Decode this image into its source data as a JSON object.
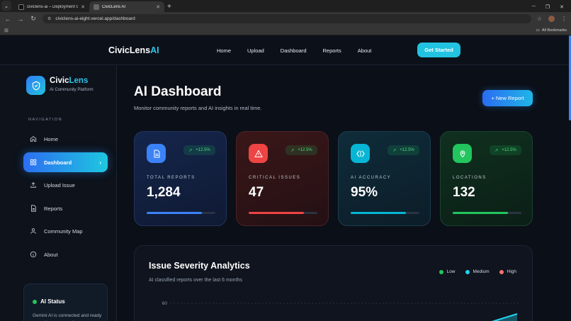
{
  "browser": {
    "tabs": [
      {
        "title": "civiclens-ai – Deployment Ove"
      },
      {
        "title": "CivicLens AI"
      }
    ],
    "url": "civiclens-ai-eight.vercel.app/dashboard",
    "bookmarks_label": "All Bookmarks"
  },
  "header": {
    "logo_main": "CivicLens",
    "logo_accent": "AI",
    "nav": [
      "Home",
      "Upload",
      "Dashboard",
      "Reports",
      "About"
    ],
    "cta_label": "Get Started"
  },
  "sidebar": {
    "brand_main": "Civic",
    "brand_accent": "Lens",
    "brand_subtitle": "AI Community Platform",
    "section_label": "NAVIGATION",
    "items": [
      {
        "label": "Home",
        "icon": "home-icon"
      },
      {
        "label": "Dashboard",
        "icon": "grid-icon"
      },
      {
        "label": "Upload Issue",
        "icon": "upload-icon"
      },
      {
        "label": "Reports",
        "icon": "document-icon"
      },
      {
        "label": "Community Map",
        "icon": "users-icon"
      },
      {
        "label": "About",
        "icon": "info-icon"
      }
    ],
    "status": {
      "title": "AI Status",
      "text": "Gemini AI is connected and ready to analyze community"
    }
  },
  "main": {
    "title": "AI Dashboard",
    "subtitle": "Monitor community reports and AI insights in real time.",
    "new_report_label": "+ New Report",
    "stats": [
      {
        "label": "TOTAL REPORTS",
        "value": "1,284",
        "trend": "+12.5%",
        "progress": 0.8,
        "color": "#3b82f6"
      },
      {
        "label": "CRITICAL ISSUES",
        "value": "47",
        "trend": "+12.5%",
        "progress": 0.8,
        "color": "#ef4444"
      },
      {
        "label": "AI ACCURACY",
        "value": "95%",
        "trend": "+12.5%",
        "progress": 0.8,
        "color": "#06b6d4"
      },
      {
        "label": "LOCATIONS",
        "value": "132",
        "trend": "+12.5%",
        "progress": 0.8,
        "color": "#22c55e"
      }
    ],
    "analytics": {
      "title": "Issue Severity Analytics",
      "subtitle": "AI classified reports over the last 6 months",
      "legend": [
        {
          "label": "Low",
          "color": "#22c55e"
        },
        {
          "label": "Medium",
          "color": "#22d3ee"
        },
        {
          "label": "High",
          "color": "#f87171"
        }
      ]
    }
  },
  "chart_data": {
    "type": "area",
    "y_ticks": [
      "60"
    ],
    "series": [
      {
        "name": "Medium",
        "color": "#22d3ee"
      }
    ]
  }
}
